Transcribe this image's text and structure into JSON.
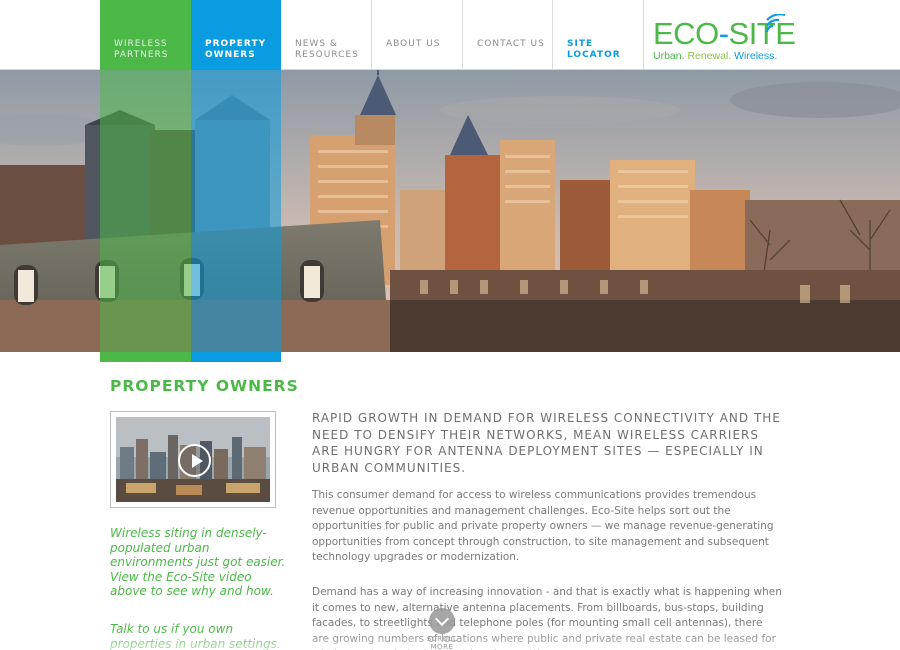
{
  "nav": {
    "items": [
      {
        "label": "WIRELESS PARTNERS"
      },
      {
        "label": "PROPERTY OWNERS"
      },
      {
        "label": "NEWS & RESOURCES"
      },
      {
        "label": "ABOUT US"
      },
      {
        "label": "CONTACT US"
      },
      {
        "label": "SITE LOCATOR"
      }
    ],
    "logo": {
      "word_a": "Eco",
      "dash": "-",
      "word_b": "Site",
      "tag_1": "Urban.",
      "tag_2": "Renewal.",
      "tag_3": "Wireless."
    }
  },
  "colors": {
    "green": "#4cb848",
    "blue": "#0a9ce0",
    "light_green": "#8cc63f",
    "text_gray": "#6f6f6f"
  },
  "content": {
    "section_title": "PROPERTY OWNERS",
    "lead": "RAPID GROWTH IN DEMAND FOR WIRELESS CONNECTIVITY AND THE NEED TO DENSIFY THEIR NETWORKS, MEAN WIRELESS CARRIERS ARE HUNGRY FOR ANTENNA DEPLOYMENT SITES — ESPECIALLY IN URBAN COMMUNITIES.",
    "para_1": "This consumer demand for access to wireless communications provides tremendous revenue opportunities and management challenges. Eco-Site helps sort out the opportunities for public and private property owners — we manage revenue-generating opportunities from concept through construction, to site management and subsequent technology upgrades or modernization.",
    "para_2": "Demand has a way of increasing innovation - and that is exactly what is happening when it comes to new, alternative antenna placements. From billboards, bus-stops, building facades, to streetlights and telephone poles (for mounting small cell antennas), there are growing numbers of locations where public and private real estate can be leased for wireless network deployment in urban settings.",
    "side_note_1": "Wireless siting in densely-populated urban environments just got easier. View the Eco-Site video above to see why and how.",
    "side_note_2": "Talk to us if you own properties in urban settings."
  },
  "video": {
    "icon": "play-icon"
  },
  "scroll": {
    "label": "SCROLL MORE",
    "icon": "chevron-down-icon"
  }
}
